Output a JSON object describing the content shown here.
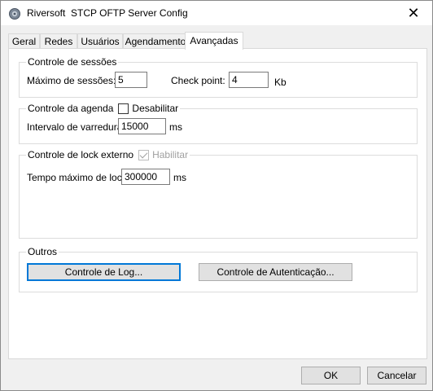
{
  "window": {
    "title": "Riversoft  STCP OFTP Server Config",
    "close_glyph": "✕"
  },
  "tabs": [
    {
      "label": "Geral",
      "active": false
    },
    {
      "label": "Redes",
      "active": false
    },
    {
      "label": "Usuários",
      "active": false
    },
    {
      "label": "Agendamento",
      "active": false
    },
    {
      "label": "Avançadas",
      "active": true
    }
  ],
  "sessions": {
    "title": "Controle de sessões",
    "max_label": "Máximo de sessões:",
    "max_value": "5",
    "checkpoint_label": "Check point:",
    "checkpoint_value": "4",
    "checkpoint_unit": "Kb"
  },
  "schedule": {
    "title": "Controle da agenda",
    "disable_label": "Desabilitar",
    "disable_checked": false,
    "interval_label": "Intervalo de varredura:",
    "interval_value": "15000",
    "interval_unit": "ms"
  },
  "lock": {
    "title": "Controle de lock externo",
    "enable_label": "Habilitar",
    "enable_checked": true,
    "enable_disabled": true,
    "max_time_label": "Tempo máximo de lock:",
    "max_time_value": "300000",
    "max_time_unit": "ms"
  },
  "others": {
    "title": "Outros",
    "log_button": "Controle de Log...",
    "auth_button": "Controle de Autenticação..."
  },
  "footer": {
    "ok_label": "OK",
    "cancel_label": "Cancelar"
  },
  "icons": {
    "app": "app-gear-icon",
    "close": "close-icon"
  },
  "colors": {
    "focus_border": "#0078d7",
    "window_bg": "#f0f0f0",
    "panel_bg": "#ffffff"
  }
}
